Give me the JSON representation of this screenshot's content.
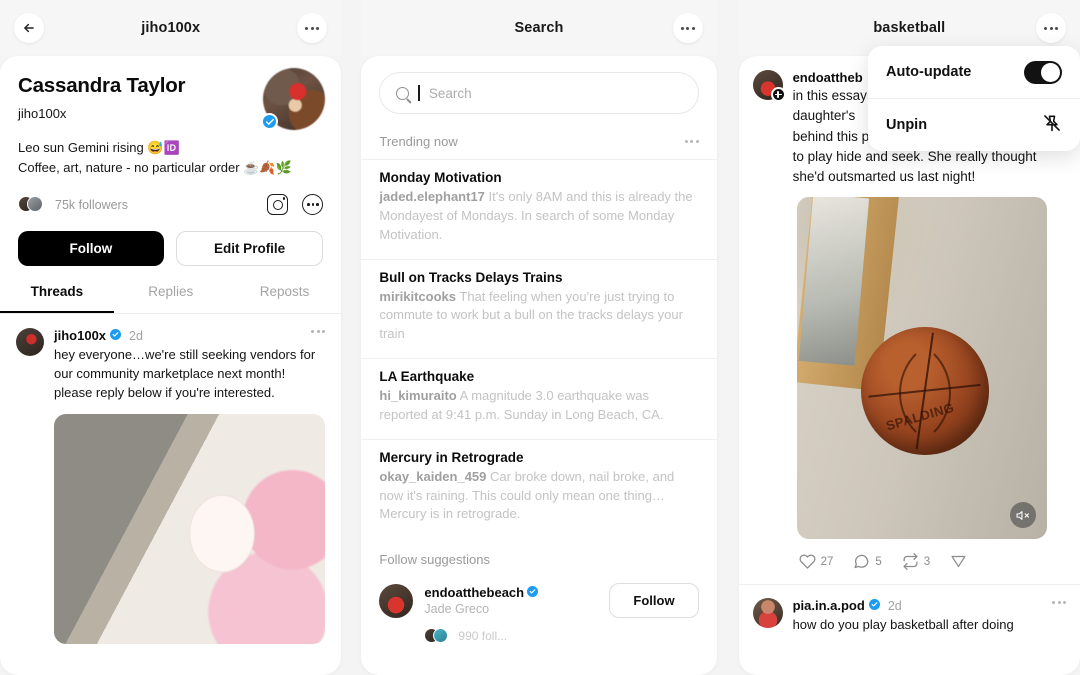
{
  "panel_profile": {
    "header_title": "jiho100x",
    "back_icon": "back-arrow-icon",
    "more_icon": "more-options-icon",
    "display_name": "Cassandra Taylor",
    "handle": "jiho100x",
    "bio_line_1": "Leo sun Gemini rising 😅🆔",
    "bio_line_2": "Coffee, art, nature - no particular order ☕🍂🌿",
    "followers": "75k followers",
    "instagram_icon": "instagram-icon",
    "profile_more_icon": "profile-more-icon",
    "follow_label": "Follow",
    "edit_profile_label": "Edit Profile",
    "tabs": [
      {
        "label": "Threads",
        "active": true
      },
      {
        "label": "Replies",
        "active": false
      },
      {
        "label": "Reposts",
        "active": false
      }
    ],
    "post": {
      "user": "jiho100x",
      "time": "2d",
      "text": "hey everyone…we're still seeking vendors for our community marketplace next month! please reply below if you're interested.",
      "more_icon": "post-more-icon",
      "image_alt": "craft supplies photo"
    }
  },
  "panel_search": {
    "header_title": "Search",
    "more_icon": "more-options-icon",
    "search_placeholder": "Search",
    "search_value": "",
    "search_icon": "search-icon",
    "trending_label": "Trending now",
    "trending_more_icon": "trending-more-icon",
    "trends": [
      {
        "title": "Monday Motivation",
        "author": "jaded.elephant17",
        "desc": "It's only 8AM and this is already the Mondayest of Mondays. In search of some Monday Motivation."
      },
      {
        "title": "Bull on Tracks Delays Trains",
        "author": "mirikitcooks",
        "desc": "That feeling when you're just trying to commute to work but a bull on the tracks delays your train"
      },
      {
        "title": "LA Earthquake",
        "author": "hi_kimuraito",
        "desc": "A magnitude 3.0 earthquake was reported at 9:41 p.m. Sunday in Long Beach, CA."
      },
      {
        "title": "Mercury in Retrograde",
        "author": "okay_kaiden_459",
        "desc": "Car broke down, nail broke, and now it's raining. This could only mean one thing… Mercury is in retrograde."
      }
    ],
    "follow_suggestions_label": "Follow suggestions",
    "suggestion": {
      "username": "endoatthebeach",
      "name": "Jade Greco",
      "follow_label": "Follow",
      "followers_peek": "990 foll..."
    }
  },
  "panel_basketball": {
    "header_title": "basketball",
    "more_icon": "more-options-icon",
    "post": {
      "user": "endoattheb",
      "text_visible": "in this essay daughter's behind this painting every night and then to play hide and seek. She really thought she'd outsmarted us last night!",
      "text_line_1": "in this essay",
      "text_line_2": "daughter's",
      "text_line_3": "behind this painting every night and then",
      "text_line_4": "to play hide and seek. She really thought",
      "text_line_5": "she'd outsmarted us last night!",
      "mute_icon": "mute-icon",
      "image_alt": "basketball wedged against picture frame"
    },
    "engagement": {
      "like_icon": "heart-icon",
      "likes": "27",
      "reply_icon": "comment-icon",
      "replies": "5",
      "repost_icon": "repost-icon",
      "reposts": "3",
      "share_icon": "share-icon"
    },
    "post2": {
      "user": "pia.in.a.pod",
      "time": "2d",
      "text": "how do you play basketball after doing",
      "more_icon": "post-more-icon"
    },
    "dropdown": {
      "items": [
        {
          "label": "Auto-update",
          "control": "toggle",
          "state": "on"
        },
        {
          "label": "Unpin",
          "control": "unpin-icon",
          "state": ""
        }
      ]
    }
  },
  "colors": {
    "verified_blue": "#1d9bf0",
    "accent_black": "#000000",
    "page_bg": "#f4f4f4",
    "card_bg": "#ffffff",
    "muted_text": "#c3c3c3"
  }
}
